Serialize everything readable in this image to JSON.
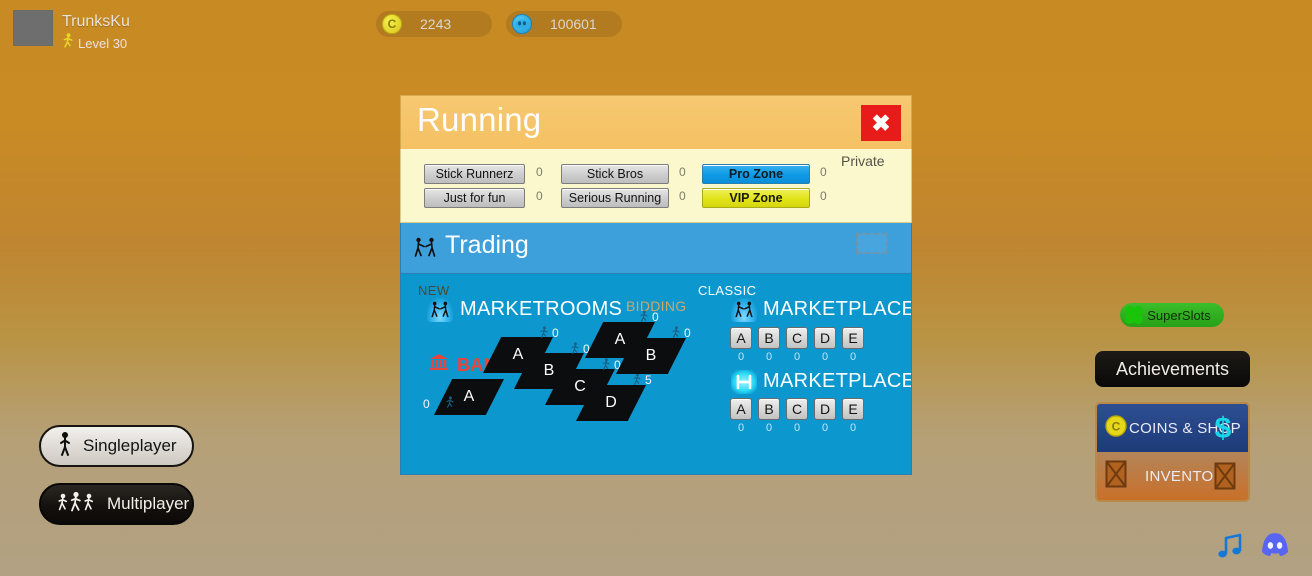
{
  "topbar": {
    "player_name": "TrunksKu",
    "level_label": "Level 30",
    "currencies": [
      {
        "icon": "coin-icon",
        "symbol": "C",
        "value": "2243"
      },
      {
        "icon": "gem-icon",
        "symbol": "",
        "value": "100601"
      }
    ]
  },
  "dialog": {
    "title": "Running",
    "close_label": "✖",
    "private_label": "Private",
    "rooms": [
      {
        "label": "Stick Runnerz",
        "count": "0",
        "style": "gray"
      },
      {
        "label": "Just for fun",
        "count": "0",
        "style": "gray"
      },
      {
        "label": "Stick Bros",
        "count": "0",
        "style": "gray"
      },
      {
        "label": "Serious Running",
        "count": "0",
        "style": "gray"
      },
      {
        "label": "Pro Zone",
        "count": "0",
        "style": "blue"
      },
      {
        "label": "VIP Zone",
        "count": "0",
        "style": "yellow"
      }
    ]
  },
  "trading": {
    "title": "Trading",
    "title_icon": "handshake-icon",
    "placeholder_icon": "dashed-placeholder-icon",
    "new": {
      "kicker": "NEW",
      "title": "MARKETROOMS",
      "icon": "handshake-icon",
      "bank_label": "BANK",
      "bank_icon": "bank-icon",
      "bidding_label": "BIDDING",
      "rooms": [
        {
          "letter": "A",
          "count": "0",
          "group": "bank"
        },
        {
          "letter": "A",
          "count": "0",
          "group": "main"
        },
        {
          "letter": "B",
          "count": "0",
          "group": "main"
        },
        {
          "letter": "C",
          "count": "0",
          "group": "main"
        },
        {
          "letter": "D",
          "count": "5",
          "group": "main"
        },
        {
          "letter": "A",
          "count": "0",
          "group": "bidding"
        },
        {
          "letter": "B",
          "count": "0",
          "group": "bidding"
        }
      ]
    },
    "classic": {
      "kicker": "CLASSIC",
      "marketplace": {
        "title": "MARKETPLACE",
        "icon": "handshake-icon",
        "keys": [
          "A",
          "B",
          "C",
          "D",
          "E"
        ],
        "counts": [
          "0",
          "0",
          "0",
          "0",
          "0"
        ]
      },
      "marketplace_plus": {
        "title": "MARKETPLACE+",
        "icon": "marketplace-plus-icon",
        "keys": [
          "A",
          "B",
          "C",
          "D",
          "E"
        ],
        "counts": [
          "0",
          "0",
          "0",
          "0",
          "0"
        ]
      }
    }
  },
  "left_menu": {
    "singleplayer": "Singleplayer",
    "multiplayer": "Multiplayer"
  },
  "right_menu": {
    "superslots": "SuperSlots",
    "achievements": "Achievements",
    "coins_shop": "COINS & SHOP",
    "inventory": "INVENTORY"
  },
  "footer": {
    "music_icon": "music-note-icon",
    "discord_icon": "discord-icon"
  }
}
